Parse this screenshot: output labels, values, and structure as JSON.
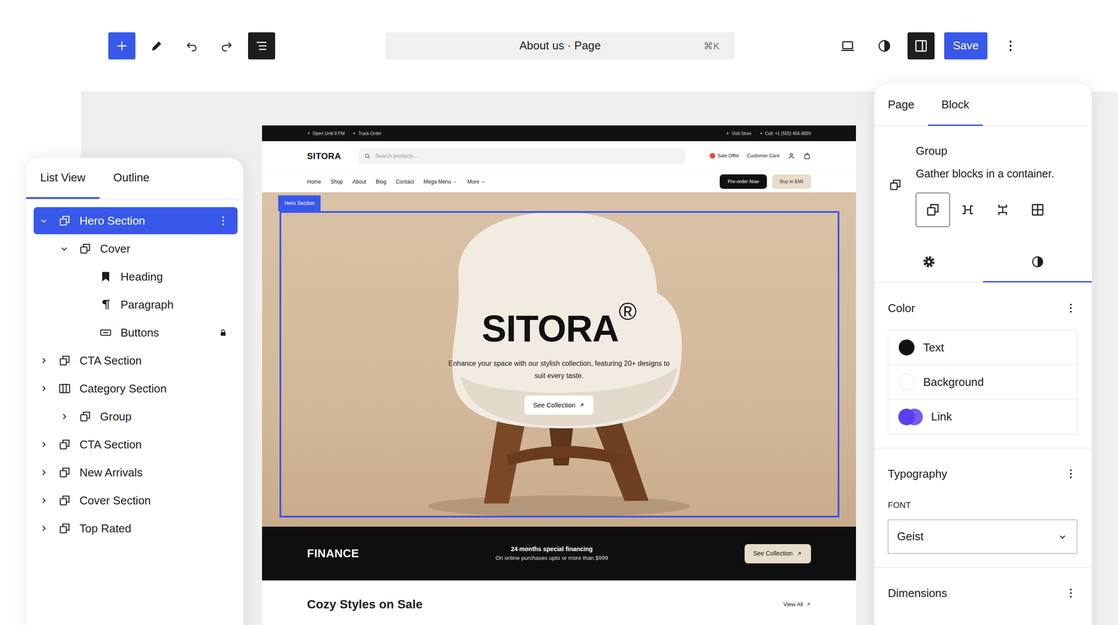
{
  "editor": {
    "title": "About us · Page",
    "shortcut": "⌘K",
    "save_button": "Save"
  },
  "list_panel": {
    "tabs": [
      {
        "label": "List View",
        "selected": true
      },
      {
        "label": "Outline",
        "selected": false
      }
    ],
    "items": [
      {
        "label": "Hero Section",
        "kind": "group",
        "depth": 0,
        "expanded": true,
        "selected": true,
        "locked": false
      },
      {
        "label": "Cover",
        "kind": "group",
        "depth": 1,
        "expanded": true,
        "selected": false,
        "locked": false
      },
      {
        "label": "Heading",
        "kind": "heading",
        "depth": 2,
        "selected": false,
        "locked": false
      },
      {
        "label": "Paragraph",
        "kind": "paragraph",
        "depth": 2,
        "selected": false,
        "locked": false
      },
      {
        "label": "Buttons",
        "kind": "buttons",
        "depth": 2,
        "selected": false,
        "locked": true
      },
      {
        "label": "CTA Section",
        "kind": "group",
        "depth": 0,
        "expanded": false,
        "selected": false,
        "locked": false
      },
      {
        "label": "Category Section",
        "kind": "columns",
        "depth": 0,
        "expanded": false,
        "selected": false,
        "locked": false
      },
      {
        "label": "Group",
        "kind": "group",
        "depth": 1,
        "expanded": false,
        "selected": false,
        "locked": false
      },
      {
        "label": "CTA Section",
        "kind": "group",
        "depth": 0,
        "expanded": false,
        "selected": false,
        "locked": false
      },
      {
        "label": "New Arrivals",
        "kind": "group",
        "depth": 0,
        "expanded": false,
        "selected": false,
        "locked": false
      },
      {
        "label": "Cover Section",
        "kind": "group",
        "depth": 0,
        "expanded": false,
        "selected": false,
        "locked": false
      },
      {
        "label": "Top Rated",
        "kind": "group",
        "depth": 0,
        "expanded": false,
        "selected": false,
        "locked": false
      }
    ]
  },
  "site": {
    "topbar": {
      "left": [
        "Open Until 8 PM",
        "Track Order"
      ],
      "right": [
        "Visit Store",
        "Call: +1 (555) 456-8899"
      ]
    },
    "logo": "SITORA",
    "search": {
      "placeholder": "Search products..."
    },
    "header_links": [
      "Sale Offer",
      "Customer Care"
    ],
    "nav": [
      {
        "label": "Home",
        "dropdown": false
      },
      {
        "label": "Shop",
        "dropdown": false
      },
      {
        "label": "About",
        "dropdown": false
      },
      {
        "label": "Blog",
        "dropdown": false
      },
      {
        "label": "Contact",
        "dropdown": false
      },
      {
        "label": "Mega Menu",
        "dropdown": true
      },
      {
        "label": "More",
        "dropdown": true
      }
    ],
    "nav_buttons": [
      {
        "label": "Pre-order Now",
        "kind": "dark"
      },
      {
        "label": "Buy in EMI",
        "kind": "light"
      }
    ],
    "hero": {
      "block_label": "Hero Section",
      "heading": "SITORA",
      "heading_mark": "®",
      "text": "Enhance your space with our stylish collection, featuring 20+ designs to suit every taste.",
      "button": "See Collection"
    },
    "finance": {
      "title": "FINANCE",
      "headline": "24 months special financing",
      "subline": "On online purchases upto or more than $999",
      "button": "See Collection"
    },
    "sale": {
      "title": "Cozy Styles on Sale",
      "link": "View All"
    }
  },
  "settings_panel": {
    "tabs": [
      {
        "label": "Page",
        "selected": false
      },
      {
        "label": "Block",
        "selected": true
      }
    ],
    "block": {
      "name": "Group",
      "description": "Gather blocks in a container.",
      "variations": [
        {
          "kind": "group",
          "selected": true
        },
        {
          "kind": "row",
          "selected": false
        },
        {
          "kind": "stack",
          "selected": false
        },
        {
          "kind": "grid",
          "selected": false
        }
      ]
    },
    "subtabs": [
      {
        "kind": "settings",
        "selected": false
      },
      {
        "kind": "styles",
        "selected": true
      }
    ],
    "color": {
      "title": "Color",
      "items": [
        {
          "label": "Text",
          "color": "#111111"
        },
        {
          "label": "Background",
          "color": "#ffffff"
        },
        {
          "label": "Link",
          "color": "#5b3ff0"
        }
      ]
    },
    "typography": {
      "title": "Typography",
      "font_label": "FONT",
      "font": "Geist"
    },
    "dimensions": {
      "title": "Dimensions"
    }
  }
}
